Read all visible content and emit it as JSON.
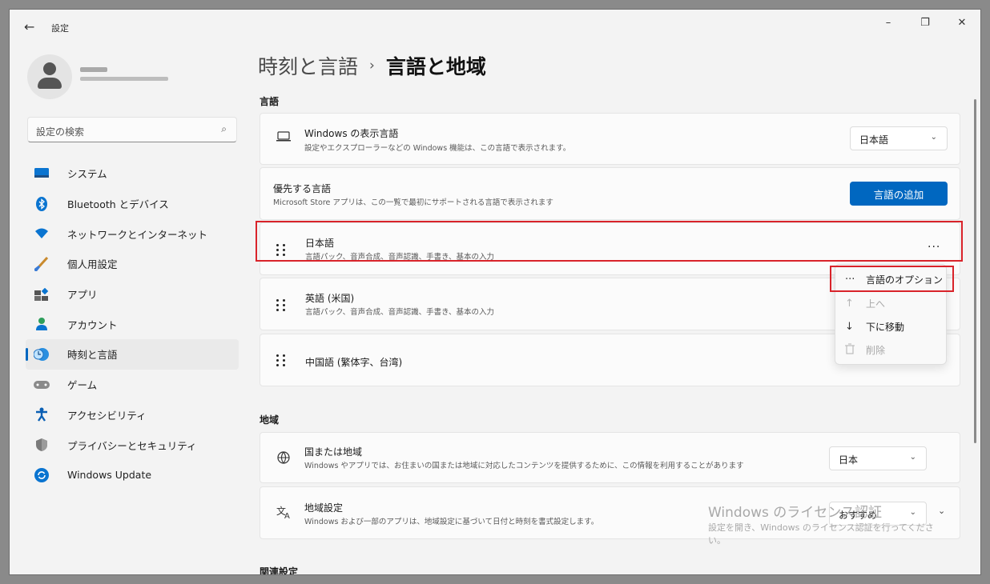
{
  "window": {
    "app_title": "設定",
    "back_icon": "←",
    "controls": {
      "minimize": "–",
      "restore": "❐",
      "close": "✕"
    }
  },
  "sidebar": {
    "search_placeholder": "設定の検索",
    "items": [
      {
        "label": "システム",
        "icon": "monitor-icon"
      },
      {
        "label": "Bluetooth とデバイス",
        "icon": "bluetooth-icon"
      },
      {
        "label": "ネットワークとインターネット",
        "icon": "wifi-icon"
      },
      {
        "label": "個人用設定",
        "icon": "brush-icon"
      },
      {
        "label": "アプリ",
        "icon": "apps-icon"
      },
      {
        "label": "アカウント",
        "icon": "person-icon"
      },
      {
        "label": "時刻と言語",
        "icon": "clock-globe-icon",
        "active": true
      },
      {
        "label": "ゲーム",
        "icon": "gamepad-icon"
      },
      {
        "label": "アクセシビリティ",
        "icon": "accessibility-icon"
      },
      {
        "label": "プライバシーとセキュリティ",
        "icon": "shield-icon"
      },
      {
        "label": "Windows Update",
        "icon": "update-icon"
      }
    ]
  },
  "breadcrumb": {
    "parent": "時刻と言語",
    "separator": "›",
    "current": "言語と地域"
  },
  "language_section": {
    "title": "言語",
    "display_language": {
      "title": "Windows の表示言語",
      "subtitle": "設定やエクスプローラーなどの Windows 機能は、この言語で表示されます。",
      "value": "日本語"
    },
    "preferred": {
      "title": "優先する言語",
      "subtitle": "Microsoft Store アプリは、この一覧で最初にサポートされる言語で表示されます",
      "add_button": "言語の追加"
    },
    "languages": [
      {
        "name": "日本語",
        "features": "言語パック、音声合成、音声認識、手書き、基本の入力"
      },
      {
        "name": "英語 (米国)",
        "features": "言語パック、音声合成、音声認識、手書き、基本の入力"
      },
      {
        "name": "中国語 (繁体字、台湾)",
        "features": ""
      }
    ],
    "more_button": "···"
  },
  "context_menu": {
    "items": [
      {
        "label": "言語のオプション",
        "icon": "more-icon",
        "glyph": "···",
        "enabled": true
      },
      {
        "label": "上へ",
        "icon": "arrow-up-icon",
        "glyph": "↑",
        "enabled": false
      },
      {
        "label": "下に移動",
        "icon": "arrow-down-icon",
        "glyph": "↓",
        "enabled": true
      },
      {
        "label": "削除",
        "icon": "trash-icon",
        "glyph": "🗑",
        "enabled": false
      }
    ]
  },
  "region_section": {
    "title": "地域",
    "country": {
      "title": "国または地域",
      "subtitle": "Windows やアプリでは、お住まいの国または地域に対応したコンテンツを提供するために、この情報を利用することがあります",
      "value": "日本"
    },
    "format": {
      "title": "地域設定",
      "subtitle": "Windows および一部のアプリは、地域設定に基づいて日付と時刻を書式設定します。",
      "value": "おすすめ"
    }
  },
  "related_section": {
    "title": "関連設定"
  },
  "watermark": {
    "title": "Windows のライセンス認証",
    "subtitle": "設定を開き、Windows のライセンス認証を行ってください。"
  },
  "colors": {
    "accent": "#0067c0",
    "highlight": "#d9232a"
  }
}
